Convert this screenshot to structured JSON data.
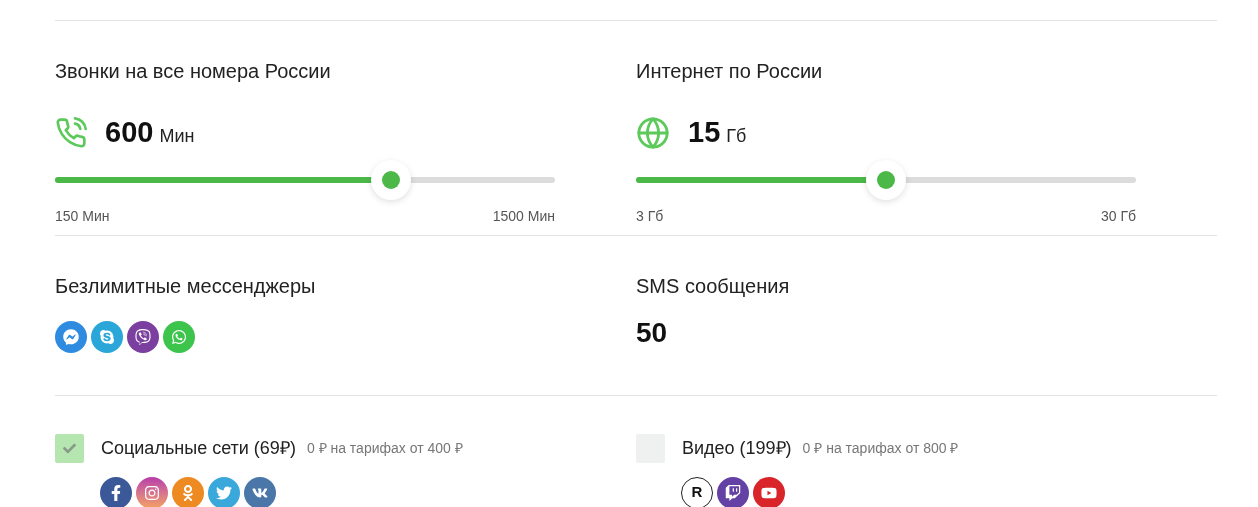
{
  "sliders": [
    {
      "title": "Звонки на все номера России",
      "kind": "calls",
      "value": "600",
      "unit": "Мин",
      "level": 0.672,
      "min_label": "150 Мин",
      "max_label": "1500 Мин"
    },
    {
      "title": "Интернет по России",
      "kind": "internet",
      "value": "15",
      "unit": "Гб",
      "level": 0.5,
      "min_label": "3 Гб",
      "max_label": "30 Гб"
    }
  ],
  "messengers": {
    "title": "Безлимитные мессенджеры",
    "icons": [
      {
        "kind": "messenger"
      },
      {
        "kind": "skype"
      },
      {
        "kind": "viber"
      },
      {
        "kind": "whatsapp"
      }
    ]
  },
  "sms": {
    "title": "SMS сообщения",
    "value": "50"
  },
  "options": [
    {
      "label": "Социальные сети (69₽)",
      "note": "0 ₽ на тарифах от 400 ₽",
      "checked": true,
      "icons": [
        {
          "kind": "facebook"
        },
        {
          "kind": "instagram"
        },
        {
          "kind": "odnoklassniki"
        },
        {
          "kind": "twitter"
        },
        {
          "kind": "vk"
        }
      ]
    },
    {
      "label": "Видео (199₽)",
      "note": "0 ₽ на тарифах от 800 ₽",
      "checked": false,
      "icons": [
        {
          "kind": "rutube",
          "label": "R"
        },
        {
          "kind": "twitch"
        },
        {
          "kind": "youtube"
        }
      ]
    }
  ]
}
